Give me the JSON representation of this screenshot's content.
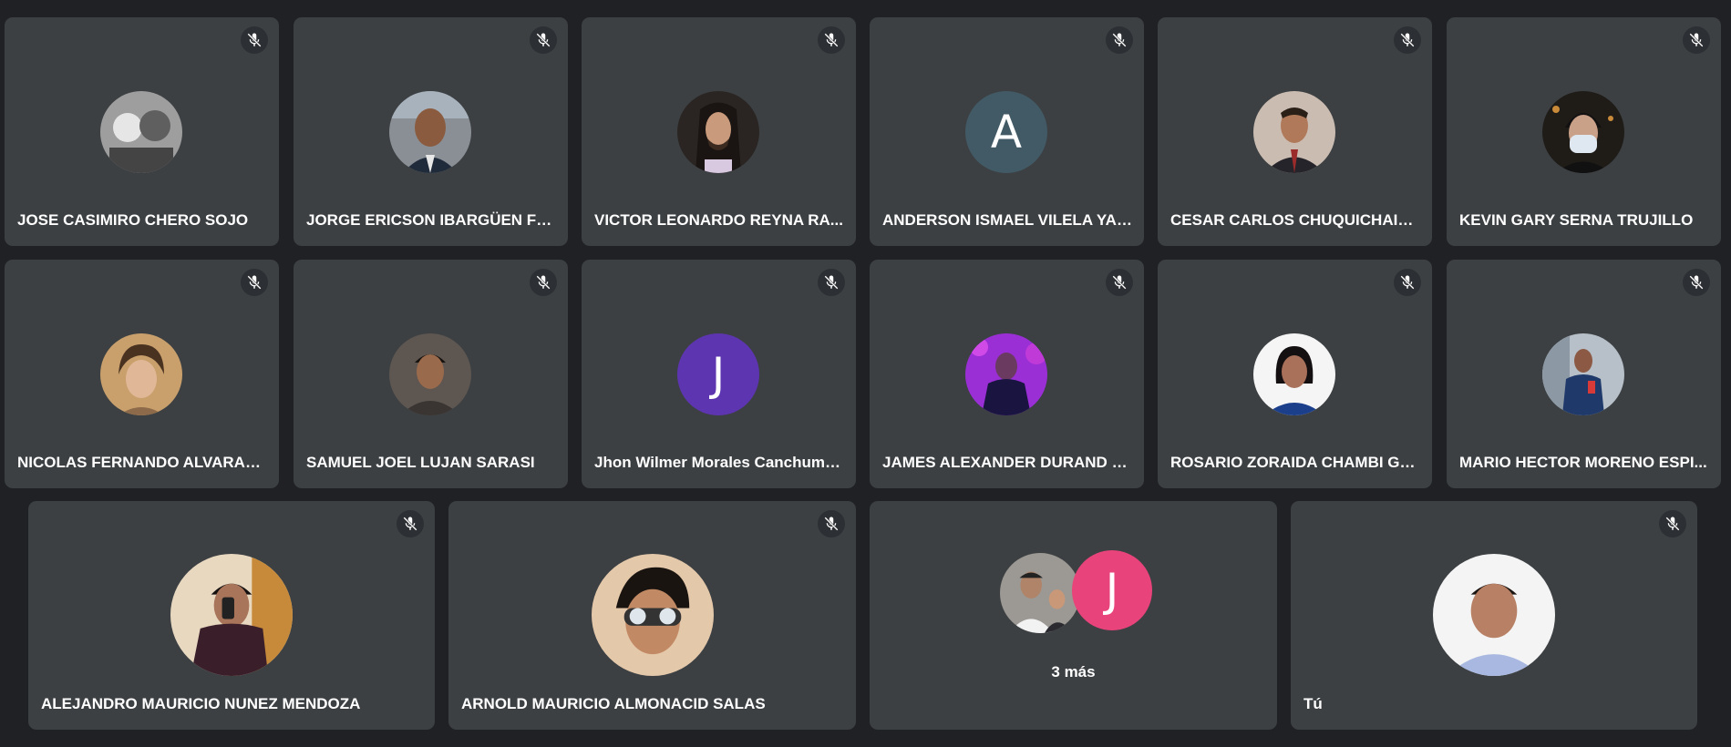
{
  "participants_row1": [
    {
      "name": "JOSE CASIMIRO CHERO SOJO",
      "avatar": "photo",
      "tone": "#8c8c8c"
    },
    {
      "name": "JORGE ERICSON IBARGÜEN FL...",
      "avatar": "photo",
      "tone": "#7a6a60"
    },
    {
      "name": "VICTOR LEONARDO REYNA RA...",
      "avatar": "photo",
      "tone": "#4a3b36"
    },
    {
      "name": "ANDERSON ISMAEL VILELA YAN...",
      "avatar": "letter",
      "letter": "A",
      "color": "#425a66"
    },
    {
      "name": "CESAR CARLOS CHUQUICHAIC...",
      "avatar": "photo",
      "tone": "#b8a79c"
    },
    {
      "name": "KEVIN GARY SERNA TRUJILLO",
      "avatar": "photo",
      "tone": "#2f2a25"
    }
  ],
  "participants_row2": [
    {
      "name": "NICOLAS FERNANDO ALVARAD...",
      "avatar": "photo",
      "tone": "#c49a70"
    },
    {
      "name": "SAMUEL JOEL LUJAN SARASI",
      "avatar": "photo",
      "tone": "#5a4a40"
    },
    {
      "name": "Jhon Wilmer Morales Canchuma...",
      "avatar": "letter",
      "letter": "J",
      "color": "#5e35b1"
    },
    {
      "name": "JAMES ALEXANDER DURAND M...",
      "avatar": "photo",
      "tone": "#8a2bc4"
    },
    {
      "name": "ROSARIO ZORAIDA CHAMBI GO...",
      "avatar": "photo",
      "tone": "#d9d6d4"
    },
    {
      "name": "MARIO HECTOR MORENO ESPI...",
      "avatar": "photo",
      "tone": "#6d7c8a"
    }
  ],
  "participants_row3": [
    {
      "name": "ALEJANDRO MAURICIO NUNEZ MENDOZA",
      "avatar": "photo",
      "tone": "#6b4d4f"
    },
    {
      "name": "ARNOLD MAURICIO ALMONACID SALAS",
      "avatar": "photo",
      "tone": "#b98a66"
    }
  ],
  "more_tile": {
    "label": "3 más",
    "photo_tone": "#9a9590",
    "letter": "J",
    "letter_color": "#e8437a"
  },
  "self_tile": {
    "name": "Tú",
    "tone": "#c7a088"
  },
  "icons": {
    "mute": "mic-off-icon"
  }
}
